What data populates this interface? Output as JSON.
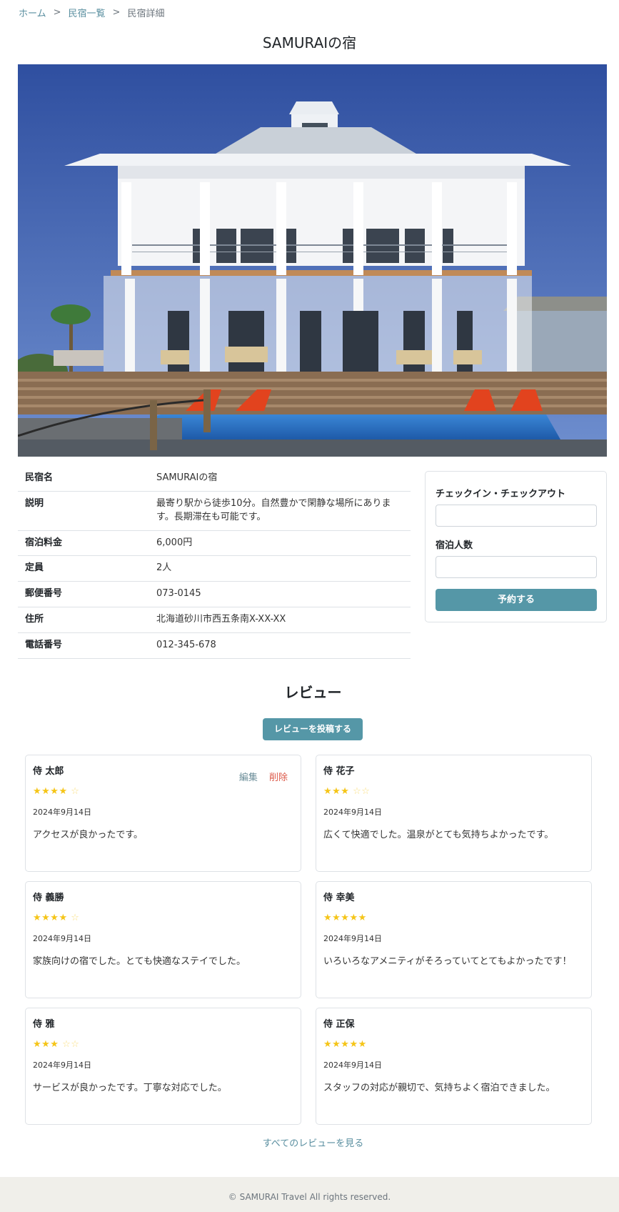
{
  "breadcrumb": {
    "home": "ホーム",
    "list": "民宿一覧",
    "current": "民宿詳細",
    "separator": ">"
  },
  "inn": {
    "title": "SAMURAIの宿",
    "rows": [
      {
        "label": "民宿名",
        "value": "SAMURAIの宿"
      },
      {
        "label": "説明",
        "value": "最寄り駅から徒歩10分。自然豊かで閑静な場所にあります。長期滞在も可能です。"
      },
      {
        "label": "宿泊料金",
        "value": "6,000円"
      },
      {
        "label": "定員",
        "value": "2人"
      },
      {
        "label": "郵便番号",
        "value": "073-0145"
      },
      {
        "label": "住所",
        "value": "北海道砂川市西五条南X-XX-XX"
      },
      {
        "label": "電話番号",
        "value": "012-345-678"
      }
    ]
  },
  "reservation": {
    "checkin_label": "チェックイン・チェックアウト",
    "checkin_value": "",
    "guests_label": "宿泊人数",
    "guests_value": "",
    "submit_label": "予約する"
  },
  "reviews": {
    "heading": "レビュー",
    "post_label": "レビューを投稿する",
    "edit_label": "編集",
    "delete_label": "削除",
    "all_label": "すべてのレビューを見る",
    "star_color": "#f5c518",
    "items": [
      {
        "name": "侍 太郎",
        "rating": 4,
        "stars": "★★★★",
        "empty": "☆",
        "date": "2024年9月14日",
        "comment": "アクセスが良かったです。"
      },
      {
        "name": "侍 花子",
        "rating": 3,
        "stars": "★★★",
        "empty": "☆☆",
        "date": "2024年9月14日",
        "comment": "広くて快適でした。温泉がとても気持ちよかったです。"
      },
      {
        "name": "侍 義勝",
        "rating": 4,
        "stars": "★★★★",
        "empty": "☆",
        "date": "2024年9月14日",
        "comment": "家族向けの宿でした。とても快適なステイでした。"
      },
      {
        "name": "侍 幸美",
        "rating": 5,
        "stars": "★★★★★",
        "empty": "",
        "date": "2024年9月14日",
        "comment": "いろいろなアメニティがそろっていてとてもよかったです！"
      },
      {
        "name": "侍 雅",
        "rating": 3,
        "stars": "★★★",
        "empty": "☆☆",
        "date": "2024年9月14日",
        "comment": "サービスが良かったです。丁寧な対応でした。"
      },
      {
        "name": "侍 正保",
        "rating": 5,
        "stars": "★★★★★",
        "empty": "",
        "date": "2024年9月14日",
        "comment": "スタッフの対応が親切で、気持ちよく宿泊できました。"
      }
    ]
  },
  "footer": {
    "copyright": "© SAMURAI Travel All rights reserved."
  },
  "colors": {
    "accent": "#5597a7",
    "link": "#5a8fa0",
    "delete": "#dc5a4a",
    "footer_bg": "#f0efea"
  }
}
